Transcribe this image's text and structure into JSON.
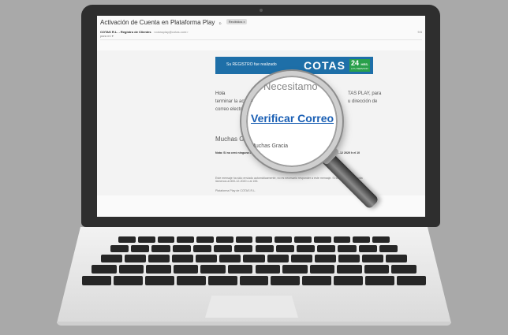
{
  "email": {
    "subject": "Activación de Cuenta en Plataforma Play",
    "subject_flag": "D",
    "inbox_tag": "Recibidos x",
    "sender_name": "COTAS R.L. - Registro de Clientes",
    "sender_email": "<cotasplay@cotas.com>",
    "recipient": "para mí",
    "date_stub": "9:5",
    "banner": {
      "text": "Su REGISTRO fue realizado",
      "logo": "COTAS",
      "badge_number": "24",
      "badge_hrs": "HRS.",
      "badge_sub": "A TU SERVICIO"
    },
    "greeting": "Hola",
    "line_1": "TAS PLAY, para",
    "line_2a": "terminar la activa",
    "line_2b": "u dirección de",
    "line_3": "correo electróni",
    "thanks": "Muchas Gracias",
    "note": "Nota: Si no creó ninguna cuenta en... Gracias !!!",
    "note_right": "...12 2020 h el 10",
    "footer_1": "Este mensaje ha sido enviado automáticamente, no es necesario responder a este mensaje. Si tiene alguna consulta llamenos al 800-12-2020 o al 155.",
    "footer_2": "Plataforma Play de COTAS R.L."
  },
  "magnifier": {
    "word_top": "Necesitamo",
    "flag_word": "ra",
    "link_label": "Verificar Correo",
    "bottom_word": "Muchas Gracia"
  }
}
